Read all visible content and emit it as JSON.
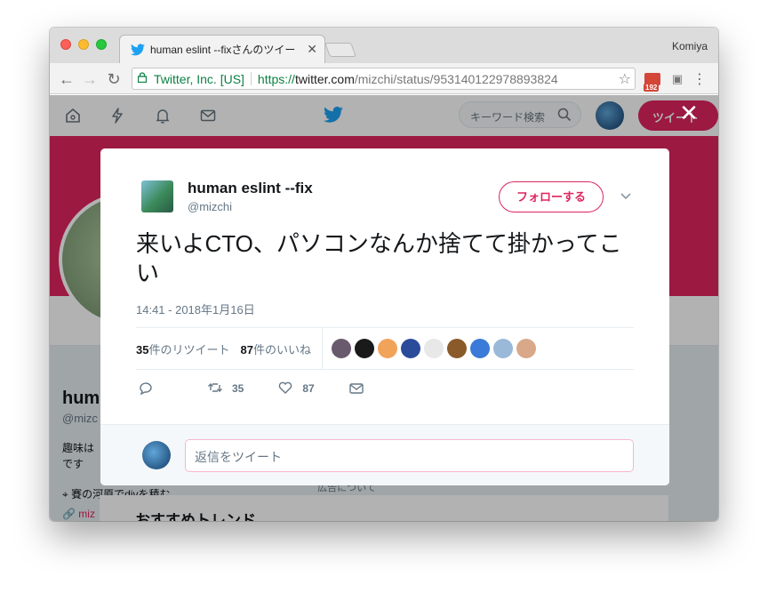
{
  "browser": {
    "tab_title": "human eslint --fixさんのツイー",
    "profile_name": "Komiya",
    "omnibox": {
      "org": "Twitter, Inc. [US]",
      "scheme": "https://",
      "host": "twitter.com",
      "path": "/mizchi/status/953140122978893824"
    },
    "gmail_count": "192"
  },
  "twitter_nav": {
    "search_placeholder": "キーワード検索",
    "tweet_button": "ツイート"
  },
  "profile": {
    "name": "hum",
    "handle": "@mizc",
    "bio": "趣味はです",
    "location": "賽の河原でdivを積む",
    "url": "miz",
    "ad_link": "広告について",
    "trends_title": "おすすめトレンド"
  },
  "tweet": {
    "author_name": "human eslint --fix",
    "author_handle": "@mizchi",
    "follow_label": "フォローする",
    "text": "来いよCTO、パソコンなんか捨てて掛かってこい",
    "time": "14:41 - 2018年1月16日",
    "retweet_count": "35",
    "retweet_label": "件のリツイート",
    "like_count": "87",
    "like_label": "件のいいね",
    "action_retweets": "35",
    "action_likes": "87",
    "reply_placeholder": "返信をツイート",
    "likers": [
      {
        "name": "liker-1",
        "color": "#6a5a6e"
      },
      {
        "name": "liker-2",
        "color": "#1a1a1a"
      },
      {
        "name": "liker-3",
        "color": "#f2a35a"
      },
      {
        "name": "liker-4",
        "color": "#2a4a9a"
      },
      {
        "name": "liker-5",
        "color": "#e8e8e8"
      },
      {
        "name": "liker-6",
        "color": "#8a5a2a"
      },
      {
        "name": "liker-7",
        "color": "#3a7ad8"
      },
      {
        "name": "liker-8",
        "color": "#9ab8d8"
      },
      {
        "name": "liker-9",
        "color": "#d8a888"
      }
    ]
  },
  "colors": {
    "twitter_blue": "#1da1f2",
    "twitter_pink": "#e0245e",
    "secure_green": "#0b8043"
  }
}
